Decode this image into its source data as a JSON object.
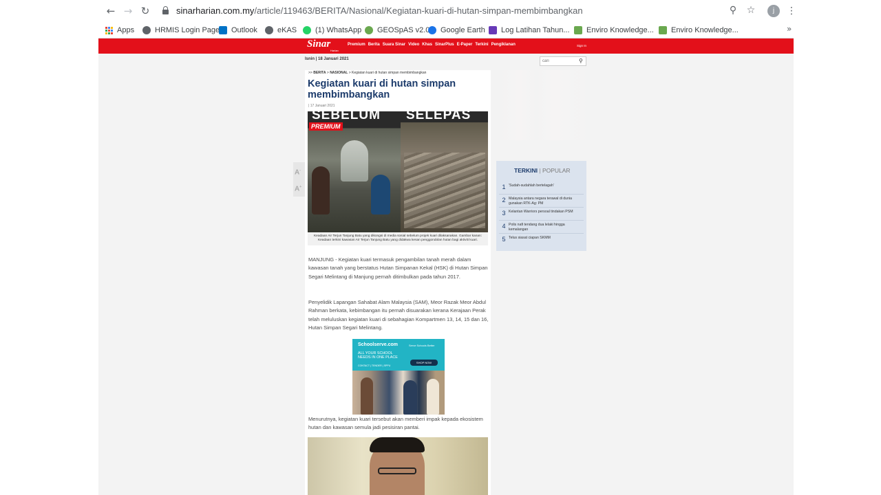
{
  "browser": {
    "url_host": "sinarharian.com.my",
    "url_path": "/article/119463/BERITA/Nasional/Kegiatan-kuari-di-hutan-simpan-membimbangkan",
    "profile_initial": "j",
    "bookmarks": [
      {
        "label": "Apps",
        "icon": "apps-icon",
        "color": "#4285f4"
      },
      {
        "label": "HRMIS Login Page",
        "icon": "globe-icon",
        "color": "#5f6368"
      },
      {
        "label": "Outlook",
        "icon": "outlook-icon",
        "color": "#0072c6"
      },
      {
        "label": "eKAS",
        "icon": "globe-icon",
        "color": "#5f6368"
      },
      {
        "label": "(1) WhatsApp",
        "icon": "whatsapp-icon",
        "color": "#25d366"
      },
      {
        "label": "GEOSpAS v2.0",
        "icon": "geospas-icon",
        "color": "#6aa84f"
      },
      {
        "label": "Google Earth",
        "icon": "google-earth-icon",
        "color": "#1a73e8"
      },
      {
        "label": "Log Latihan Tahun...",
        "icon": "forms-icon",
        "color": "#673ab7"
      },
      {
        "label": "Enviro Knowledge...",
        "icon": "enviro-icon",
        "color": "#6aa84f"
      },
      {
        "label": "Enviro Knowledge...",
        "icon": "enviro-icon",
        "color": "#6aa84f"
      }
    ]
  },
  "site": {
    "logo": "Sinar",
    "logo_sub": "Harian",
    "nav": [
      "Premium",
      "Berita",
      "Suara Sinar",
      "Video",
      "Khas",
      "SinarPlus",
      "E-Paper",
      "Terkini",
      "Pengiklanan"
    ],
    "signin": "Sign In",
    "date": "Isnin | 18 Januari 2021",
    "search_placeholder": "cari",
    "brand_color": "#e3101a"
  },
  "article": {
    "breadcrumb_prefix": ">> ",
    "breadcrumb_section": "BERITA",
    "breadcrumb_sub": "NASIONAL",
    "breadcrumb_title": "Kegiatan kuari di hutan simpan membimbangkan",
    "title": "Kegiatan kuari di hutan simpan membimbangkan",
    "date": "| 17 Januari 2021",
    "image_label_left": "SEBELUM",
    "image_label_right": "SELEPAS",
    "premium_badge": "PREMIUM",
    "caption": "Keadaan Air Terjun Tanjung Batu yang dikongsi di media sosial sebelum projek kuari dilaksanakan. Gambar kanan: Keadaan terkini kawasan Air Terjun Tanjung Batu yang didakwa kesan penggondolan hutan bagi aktiviti kuari.",
    "paragraphs": [
      "MANJUNG - Kegiatan kuari termasuk pengambilan tanah merah dalam kawasan tanah yang berstatus Hutan Simpanan Kekal (HSK) di Hutan Simpan Segari Melintang di Manjung pernah ditimbulkan pada tahun 2017.",
      "Penyelidik Lapangan Sahabat Alam Malaysia (SAM), Meor Razak Meor Abdul Rahman berkata, kebimbangan itu pernah disuarakan kerana Kerajaan Perak telah meluluskan kegiatan kuari di sebahagian Kompartmen 13, 14, 15 dan 16, Hutan Simpan Segari Melintang.",
      "Menurutnya, kegiatan kuari tersebut akan memberi impak kepada ekosistem hutan dan kawasan semula jadi pesisiran pantai."
    ]
  },
  "ad": {
    "brand": "Schoolserve.com",
    "tagline": "Serve Schools Better",
    "headline": "ALL YOUR SCHOOL NEEDS IN ONE PLACE",
    "cta": "SHOP NOW",
    "links": "CONTACT | TENDER | SPPU"
  },
  "widget": {
    "tab_active": "TERKINI",
    "tab_inactive": "POPULAR",
    "items": [
      {
        "num": "1",
        "text": "'Sudah-sudahlah bertelagah'"
      },
      {
        "num": "2",
        "text": "Malaysia antara negara terawal di dunia gunakan RTK-Ag: PM"
      },
      {
        "num": "3",
        "text": "Kelantan Warriors persoal tindakan PSM"
      },
      {
        "num": "4",
        "text": "Polis nafi tendang dua lelaki hingga kemalangan"
      },
      {
        "num": "5",
        "text": "Telus siasat ciapan SKMM"
      }
    ]
  }
}
